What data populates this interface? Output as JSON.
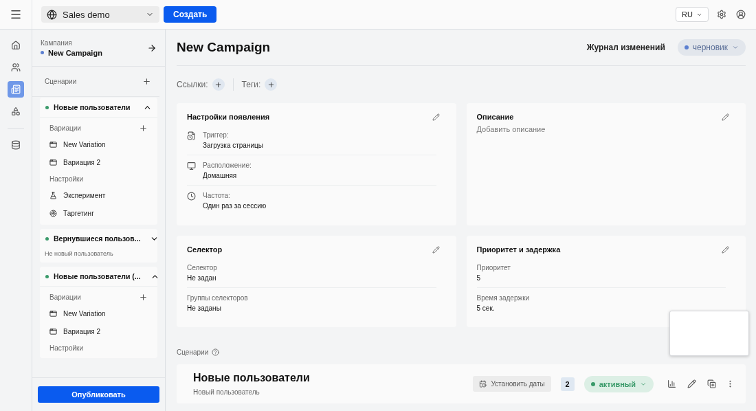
{
  "topbar": {
    "workspace": "Sales demo",
    "create_button": "Создать",
    "language": "RU"
  },
  "rail": [
    {
      "kind": "home",
      "selected": false
    },
    {
      "kind": "users",
      "selected": false
    },
    {
      "kind": "list",
      "selected": true
    },
    {
      "kind": "shapes",
      "selected": false
    },
    {
      "kind": "database",
      "selected": false
    }
  ],
  "sidebar": {
    "campaign_label": "Кампания",
    "campaign_name": "New Campaign",
    "scenarios_label": "Сценарии",
    "scenarios": [
      {
        "name": "Новые пользователи",
        "color": "#3a9a6a",
        "expanded": true,
        "sections": [
          {
            "title": "Вариации",
            "addable": true,
            "items": [
              {
                "kind": "variation",
                "label": "New Variation"
              },
              {
                "kind": "variation",
                "label": "Вариация 2"
              }
            ]
          },
          {
            "title": "Настройки",
            "addable": false,
            "items": [
              {
                "kind": "experiment",
                "label": "Эксперимент"
              },
              {
                "kind": "targeting",
                "label": "Таргетинг"
              }
            ]
          }
        ]
      },
      {
        "name": "Вернувшиеся пользов...",
        "color": "#3a9a6a",
        "expanded": false,
        "subtitle": "Не новый пользователь"
      },
      {
        "name": "Новые пользователи (...",
        "color": "#3a9a6a",
        "expanded": true,
        "sections": [
          {
            "title": "Вариации",
            "addable": true,
            "items": [
              {
                "kind": "variation",
                "label": "New Variation"
              },
              {
                "kind": "variation",
                "label": "Вариация 2"
              }
            ]
          },
          {
            "title": "Настройки",
            "addable": false
          }
        ]
      }
    ],
    "publish_button": "Опубликовать"
  },
  "main": {
    "title": "New Campaign",
    "changelog": "Журнал изменений",
    "status": {
      "label": "черновик",
      "color": "#5b7fd0"
    },
    "links_label": "Ссылки:",
    "tags_label": "Теги:",
    "cards": [
      {
        "kind": "iconlist",
        "title": "Настройки появления",
        "rows": [
          {
            "label": "Триггер:",
            "value": "Загрузка страницы"
          },
          {
            "label": "Расположение:",
            "value": "Домашняя"
          },
          {
            "label": "Частота:",
            "value": "Один раз за сессию"
          }
        ]
      },
      {
        "kind": "text",
        "title": "Описание",
        "hint": "Добавить описание"
      },
      {
        "kind": "list",
        "title": "Селектор",
        "rows": [
          {
            "label": "Селектор",
            "value": "Не задан"
          },
          {
            "label": "Группы селекторов",
            "value": "Не заданы"
          }
        ]
      },
      {
        "kind": "list",
        "title": "Приоритет и задержка",
        "rows": [
          {
            "label": "Приоритет",
            "value": "5"
          },
          {
            "label": "Время задержки",
            "value": "5 сек."
          }
        ]
      }
    ],
    "scenarios_label": "Сценарии",
    "scenario": {
      "name": "Новые пользователи",
      "subtitle": "Новый пользователь",
      "dates_button": "Установить даты",
      "count": "2",
      "status": {
        "label": "активный",
        "color": "#3a9a6a"
      }
    }
  }
}
